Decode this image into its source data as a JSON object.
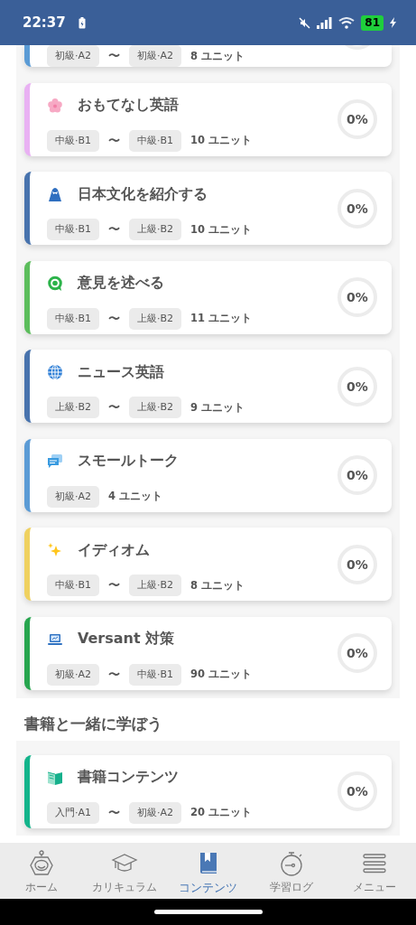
{
  "status_bar": {
    "time": "22:37",
    "battery": "81"
  },
  "top_card_fragment": {
    "color": "#5b9bd5",
    "levels": [
      "初級·A2",
      "初級·A2"
    ],
    "separator": "〜",
    "units": "8 ユニット"
  },
  "courses": [
    {
      "title": "おもてなし英語",
      "color": "#e9b1f3",
      "levels": [
        "中級·B1",
        "中級·B1"
      ],
      "separator": "〜",
      "units": "10 ユニット",
      "progress": {
        "level": 0,
        "text": "0%"
      }
    },
    {
      "title": "日本文化を紹介する",
      "color": "#4873ad",
      "levels": [
        "中級·B1",
        "上級·B2"
      ],
      "separator": "〜",
      "units": "10 ユニット",
      "progress": {
        "level": 0,
        "text": "0%"
      }
    },
    {
      "title": "意見を述べる",
      "color": "#5cbd5c",
      "levels": [
        "中級·B1",
        "上級·B2"
      ],
      "separator": "〜",
      "units": "11 ユニット",
      "progress": {
        "level": 0,
        "text": "0%"
      }
    },
    {
      "title": "ニュース英語",
      "color": "#4873ad",
      "levels": [
        "上級·B2",
        "上級·B2"
      ],
      "separator": "〜",
      "units": "9 ユニット",
      "progress": {
        "level": 0,
        "text": "0%"
      }
    },
    {
      "title": "スモールトーク",
      "color": "#5b9bd5",
      "levels": [
        "初級·A2"
      ],
      "units": "4 ユニット",
      "progress": {
        "level": 0,
        "text": "0%"
      }
    },
    {
      "title": "イディオム",
      "color": "#efd160",
      "levels": [
        "中級·B1",
        "上級·B2"
      ],
      "separator": "〜",
      "units": "8 ユニット",
      "progress": {
        "level": 0,
        "text": "0%"
      }
    },
    {
      "title": "Versant 対策",
      "color": "#27a54e",
      "levels": [
        "初級·A2",
        "中級·B1"
      ],
      "separator": "〜",
      "units": "90 ユニット",
      "progress": {
        "level": 0,
        "text": "0%"
      }
    }
  ],
  "book_section": {
    "heading": "書籍と一緒に学ぼう",
    "courses": [
      {
        "title": "書籍コンテンツ",
        "color": "#13b48b",
        "levels": [
          "入門·A1",
          "初級·A2"
        ],
        "separator": "〜",
        "units": "20 ユニット",
        "progress": {
          "level": 0,
          "text": "0%"
        }
      }
    ]
  },
  "bottom_nav": [
    {
      "label": "ホーム",
      "selected": false
    },
    {
      "label": "カリキュラム",
      "selected": false
    },
    {
      "label": "コンテンツ",
      "selected": true
    },
    {
      "label": "学習ログ",
      "selected": false
    },
    {
      "label": "メニュー",
      "selected": false
    }
  ]
}
